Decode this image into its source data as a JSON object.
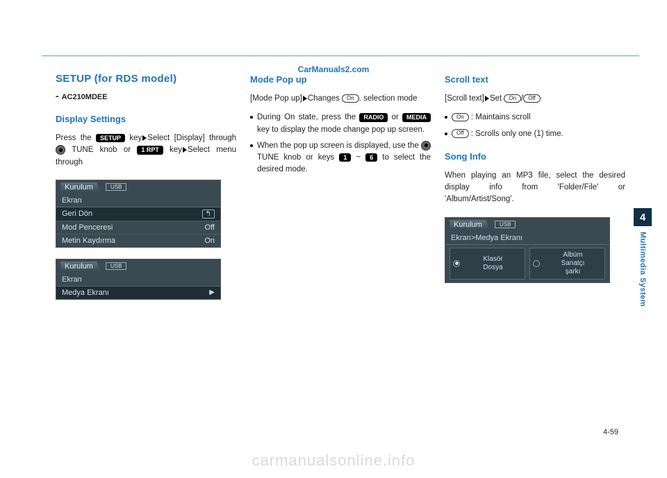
{
  "brand_site": "CarManuals2.com",
  "setup_title": "SETUP (for RDS model)",
  "model_code": "AC210MDEE",
  "display_settings_header": "Display Settings",
  "ds_body": {
    "p1a": "Press the ",
    "setup_key": "SETUP",
    "p1b": " key",
    "p1c": "Select [Display] through ",
    "p1d": " TUNE knob or ",
    "rpt_key": "1 RPT",
    "p1e": " key",
    "p1f": "Select menu through"
  },
  "screen1": {
    "title": "Kurulum",
    "badge": "USB",
    "sub": "Ekran",
    "rows": [
      {
        "label": "Geri Dön",
        "value_type": "back"
      },
      {
        "label": "Mod Penceresi",
        "value": "Off"
      },
      {
        "label": "Metin Kaydırma",
        "value": "On"
      }
    ]
  },
  "screen2": {
    "title": "Kurulum",
    "badge": "USB",
    "sub": "Ekran",
    "rows": [
      {
        "label": "Medya Ekranı",
        "value_type": "arrow"
      }
    ]
  },
  "mode_popup": {
    "header": "Mode Pop up",
    "p1a": "[Mode Pop up]",
    "p1b": "Changes ",
    "on": "On",
    "p1c": ". selection mode",
    "b1a": "During On state, press the ",
    "radio": "RADIO",
    "b1b": " or ",
    "media": "MEDIA",
    "b1c": " key to display the mode change pop up screen.",
    "b2a": "When the pop up screen is displayed, use the ",
    "b2b": " TUNE knob or keys ",
    "k1": "1",
    "k_tilde": "~",
    "k6": "6",
    "b2c": " to select the desired mode."
  },
  "scroll_text": {
    "header": "Scroll text",
    "p1a": "[Scroll text]",
    "p1b": "Set ",
    "on": "On",
    "slash": "/",
    "off": "Off",
    "b1_on": "On",
    "b1_txt": " : Maintains scroll",
    "b2_off": "Off",
    "b2_txt": " : Scrolls only one (1) time."
  },
  "song_info": {
    "header": "Song Info",
    "body": "When playing an MP3 file, select the desired display info from 'Folder/File' or 'Album/Artist/Song'.",
    "screen": {
      "title": "Kurulum",
      "badge": "USB",
      "sub": "Ekran>Medya Ekranı",
      "left": "Klasör\nDosya",
      "right": "Albüm\nSanatçı\nşarkı"
    }
  },
  "sidetab": {
    "num": "4",
    "label": "Multimedia System"
  },
  "page_number": "4-59",
  "watermark": "carmanualsonline.info"
}
